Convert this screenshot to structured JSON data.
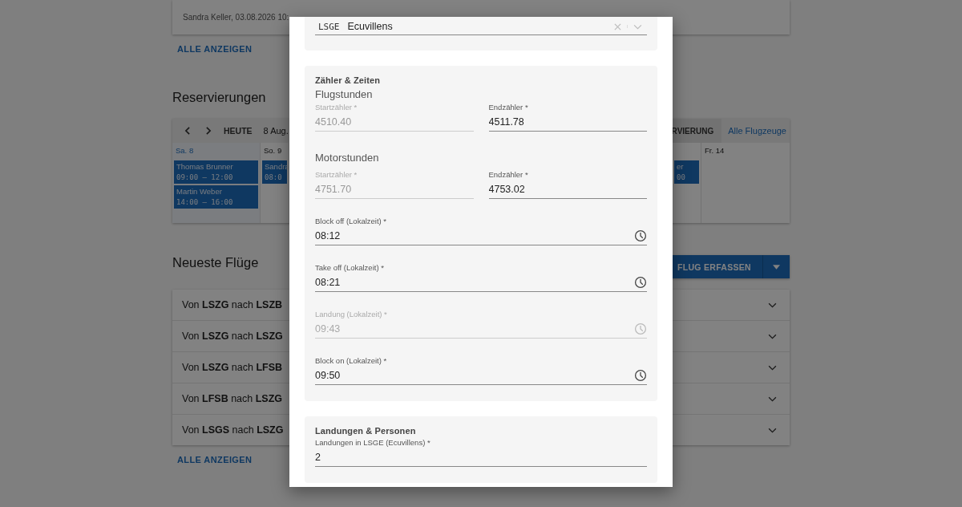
{
  "background": {
    "comment_meta": "Sandra Keller, 03.08.2026 10:",
    "show_all_link": "ALLE ANZEIGEN",
    "reservations": {
      "title": "Reservierungen",
      "today_button": "HEUTE",
      "date_label": "8 Aug.",
      "reservation_button": "RVIERUNG",
      "aircraft_link": "Alle Flugzeuge",
      "days": [
        {
          "label": "Sa. 8",
          "selected": true,
          "events": [
            {
              "name": "Thomas Brunner",
              "time": "09:00 — 12:00"
            },
            {
              "name": "Martin Weber",
              "time": "14:00 — 16:00"
            }
          ]
        },
        {
          "label": "So. 9",
          "selected": false,
          "events": [
            {
              "name": "Sandra",
              "time": "08:0"
            }
          ]
        },
        {
          "events": [
            {
              "name": "er",
              "time": "00"
            }
          ]
        },
        {
          "label": "Fr. 14",
          "selected": false
        }
      ]
    },
    "latest_flights": {
      "title": "Neueste Flüge",
      "add_button": "FLUG ERFASSEN",
      "show_all_link": "ALLE ANZEIGEN",
      "flights": [
        {
          "text": "Von **LSZG** nach **LSZB**",
          "expanded": false
        },
        {
          "text": "Von **LSZG** nach **LSZG**",
          "expanded": false
        },
        {
          "text": "Von **LSZG** nach **LFSB**",
          "expanded": false
        },
        {
          "text": "Von **LFSB** nach **LSZG**",
          "expanded": false
        },
        {
          "text": "Von **LSGS** nach **LSZG**",
          "expanded": false
        }
      ]
    }
  },
  "dialog": {
    "airport_field": {
      "code": "LSGE",
      "name": "Ecuvillens"
    },
    "sections": [
      {
        "title": "Zähler & Zeiten",
        "items": [
          {
            "kind": "subheading",
            "text": "Flugstunden"
          },
          {
            "kind": "pair",
            "start": {
              "label": "Startzähler *",
              "value": "4510.40",
              "disabled": true
            },
            "end": {
              "label": "Endzähler *",
              "value": "4511.78",
              "disabled": false
            }
          },
          {
            "kind": "subheading",
            "text": "Motorstunden"
          },
          {
            "kind": "pair",
            "start": {
              "label": "Startzähler *",
              "value": "4751.70",
              "disabled": true
            },
            "end": {
              "label": "Endzähler *",
              "value": "4753.02",
              "disabled": false
            }
          },
          {
            "kind": "time",
            "label": "Block off (Lokalzeit) *",
            "value": "08:12",
            "disabled": false
          },
          {
            "kind": "time",
            "label": "Take off (Lokalzeit) *",
            "value": "08:21",
            "disabled": false
          },
          {
            "kind": "time",
            "label": "Landung (Lokalzeit) *",
            "value": "09:43",
            "disabled": true
          },
          {
            "kind": "time",
            "label": "Block on (Lokalzeit) *",
            "value": "09:50",
            "disabled": false
          }
        ]
      },
      {
        "title": "Landungen & Personen",
        "items": [
          {
            "kind": "number",
            "label": "Landungen in LSGE (Ecuvillens) *",
            "value": "2",
            "disabled": false
          }
        ]
      }
    ]
  }
}
